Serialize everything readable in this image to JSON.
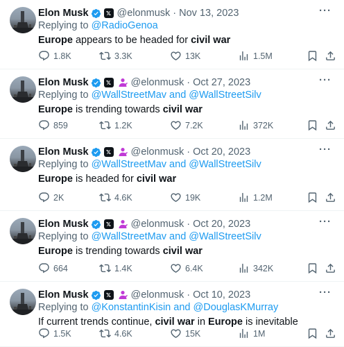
{
  "colors": {
    "accent": "#1d9bf0",
    "secondary_text": "#536471",
    "primary_text": "#0f1419",
    "verified": "#1d9bf0",
    "affiliation": "#c03ad6"
  },
  "tweets": [
    {
      "author": "Elon Musk",
      "handle": "@elonmusk",
      "separator": "·",
      "date": "Nov 13, 2023",
      "has_affiliation_icon": false,
      "reply_prefix": "Replying to",
      "reply_to": "@RadioGenoa",
      "text_parts": [
        {
          "t": "Europe",
          "b": true
        },
        {
          "t": " appears to be headed for ",
          "b": false
        },
        {
          "t": "civil war",
          "b": true
        }
      ],
      "replies": "1.8K",
      "reposts": "3.3K",
      "likes": "13K",
      "views": "1.5M"
    },
    {
      "author": "Elon Musk",
      "handle": "@elonmusk",
      "separator": "·",
      "date": "Oct 27, 2023",
      "has_affiliation_icon": true,
      "reply_prefix": "Replying to",
      "reply_to": "@WallStreetMav and @WallStreetSilv",
      "text_parts": [
        {
          "t": "Europe",
          "b": true
        },
        {
          "t": " is trending towards ",
          "b": false
        },
        {
          "t": "civil war",
          "b": true
        }
      ],
      "replies": "859",
      "reposts": "1.2K",
      "likes": "7.2K",
      "views": "372K"
    },
    {
      "author": "Elon Musk",
      "handle": "@elonmusk",
      "separator": "·",
      "date": "Oct 20, 2023",
      "has_affiliation_icon": true,
      "reply_prefix": "Replying to",
      "reply_to": "@WallStreetMav and @WallStreetSilv",
      "text_parts": [
        {
          "t": "Europe",
          "b": true
        },
        {
          "t": " is headed for ",
          "b": false
        },
        {
          "t": "civil war",
          "b": true
        }
      ],
      "replies": "2K",
      "reposts": "4.6K",
      "likes": "19K",
      "views": "1.2M"
    },
    {
      "author": "Elon Musk",
      "handle": "@elonmusk",
      "separator": "·",
      "date": "Oct 20, 2023",
      "has_affiliation_icon": true,
      "reply_prefix": "Replying to",
      "reply_to": "@WallStreetMav and @WallStreetSilv",
      "text_parts": [
        {
          "t": "Europe",
          "b": true
        },
        {
          "t": " is trending towards ",
          "b": false
        },
        {
          "t": "civil war",
          "b": true
        }
      ],
      "replies": "664",
      "reposts": "1.4K",
      "likes": "6.4K",
      "views": "342K"
    },
    {
      "author": "Elon Musk",
      "handle": "@elonmusk",
      "separator": "·",
      "date": "Oct 10, 2023",
      "has_affiliation_icon": true,
      "reply_prefix": "Replying to",
      "reply_to": "@KonstantinKisin and @DouglasKMurray",
      "text_parts": [
        {
          "t": "If current trends continue, ",
          "b": false
        },
        {
          "t": "civil war",
          "b": true
        },
        {
          "t": " in ",
          "b": false
        },
        {
          "t": "Europe",
          "b": true
        },
        {
          "t": " is inevitable",
          "b": false
        }
      ],
      "replies": "1.5K",
      "reposts": "4.6K",
      "likes": "15K",
      "views": "1M"
    }
  ],
  "icons": [
    "avatar",
    "verified-badge-icon",
    "x-logo-icon",
    "affiliation-icon",
    "more-icon",
    "reply-icon",
    "repost-icon",
    "like-icon",
    "views-icon",
    "bookmark-icon",
    "share-icon"
  ]
}
